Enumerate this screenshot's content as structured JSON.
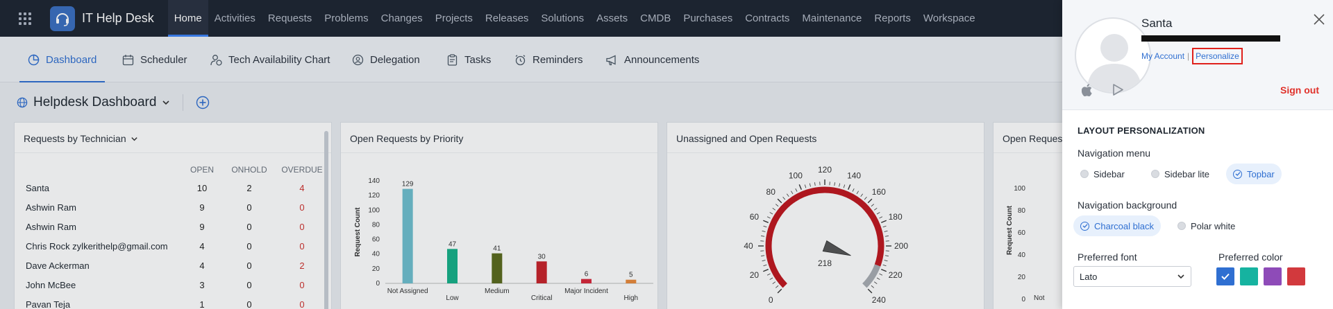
{
  "topbar": {
    "app_title": "IT Help Desk",
    "nav": [
      "Home",
      "Activities",
      "Requests",
      "Problems",
      "Changes",
      "Projects",
      "Releases",
      "Solutions",
      "Assets",
      "CMDB",
      "Purchases",
      "Contracts",
      "Maintenance",
      "Reports",
      "Workspace"
    ],
    "active": "Home"
  },
  "subtabs": [
    "Dashboard",
    "Scheduler",
    "Tech Availability Chart",
    "Delegation",
    "Tasks",
    "Reminders",
    "Announcements"
  ],
  "dashboard": {
    "title": "Helpdesk Dashboard",
    "widgets": {
      "technician": {
        "title": "Requests by Technician",
        "columns": [
          "OPEN",
          "ONHOLD",
          "OVERDUE"
        ],
        "rows": [
          {
            "name": "Santa",
            "open": "10",
            "onhold": "2",
            "overdue": "4"
          },
          {
            "name": "Ashwin Ram",
            "open": "9",
            "onhold": "0",
            "overdue": "0"
          },
          {
            "name": "Ashwin Ram",
            "open": "9",
            "onhold": "0",
            "overdue": "0"
          },
          {
            "name": "Chris Rock zylkerithelp@gmail.com",
            "open": "4",
            "onhold": "0",
            "overdue": "0"
          },
          {
            "name": "Dave Ackerman",
            "open": "4",
            "onhold": "0",
            "overdue": "2"
          },
          {
            "name": "John McBee",
            "open": "3",
            "onhold": "0",
            "overdue": "0"
          },
          {
            "name": "Pavan Teja",
            "open": "1",
            "onhold": "0",
            "overdue": "0"
          }
        ]
      },
      "priority": {
        "title": "Open Requests by Priority"
      },
      "unassigned": {
        "title": "Unassigned and Open Requests"
      },
      "fourth": {
        "title": "Open Request",
        "ylabel": "Request Count",
        "yticks": [
          "100",
          "80",
          "60",
          "40",
          "20",
          "0"
        ],
        "xlabel_partial": "Not"
      }
    }
  },
  "chart_data": [
    {
      "type": "bar",
      "title": "Open Requests by Priority",
      "ylabel": "Request Count",
      "categories": [
        "Not Assigned",
        "Low",
        "Medium",
        "Critical",
        "Major Incident",
        "High"
      ],
      "values": [
        129,
        47,
        41,
        30,
        6,
        5
      ],
      "ylim": [
        0,
        140
      ],
      "yticks": [
        0,
        20,
        40,
        60,
        80,
        100,
        120,
        140
      ],
      "colors": [
        "#6fbfcf",
        "#17b088",
        "#5b6a1d",
        "#c8232a",
        "#d8283a",
        "#e98a3a"
      ]
    },
    {
      "type": "gauge",
      "title": "Unassigned and Open Requests",
      "value": 218,
      "range": [
        0,
        240
      ],
      "tick_labels": [
        "0",
        "20",
        "40",
        "60",
        "80",
        "100",
        "120",
        "140",
        "160",
        "180",
        "200",
        "220",
        "240"
      ]
    }
  ],
  "panel": {
    "name": "Santa",
    "my_account": "My Account",
    "personalize": "Personalize",
    "sign_out": "Sign out",
    "section_title": "LAYOUT PERSONALIZATION",
    "nav_menu_label": "Navigation menu",
    "nav_menu_options": [
      "Sidebar",
      "Sidebar lite",
      "Topbar"
    ],
    "nav_menu_selected": "Topbar",
    "nav_bg_label": "Navigation background",
    "nav_bg_options": [
      "Charcoal black",
      "Polar white"
    ],
    "nav_bg_selected": "Charcoal black",
    "font_label": "Preferred font",
    "font_value": "Lato",
    "color_label": "Preferred color",
    "colors": [
      "#2f6fd1",
      "#16b3a0",
      "#8e4bb8",
      "#d2393d"
    ],
    "selected_color": "#2f6fd1"
  }
}
